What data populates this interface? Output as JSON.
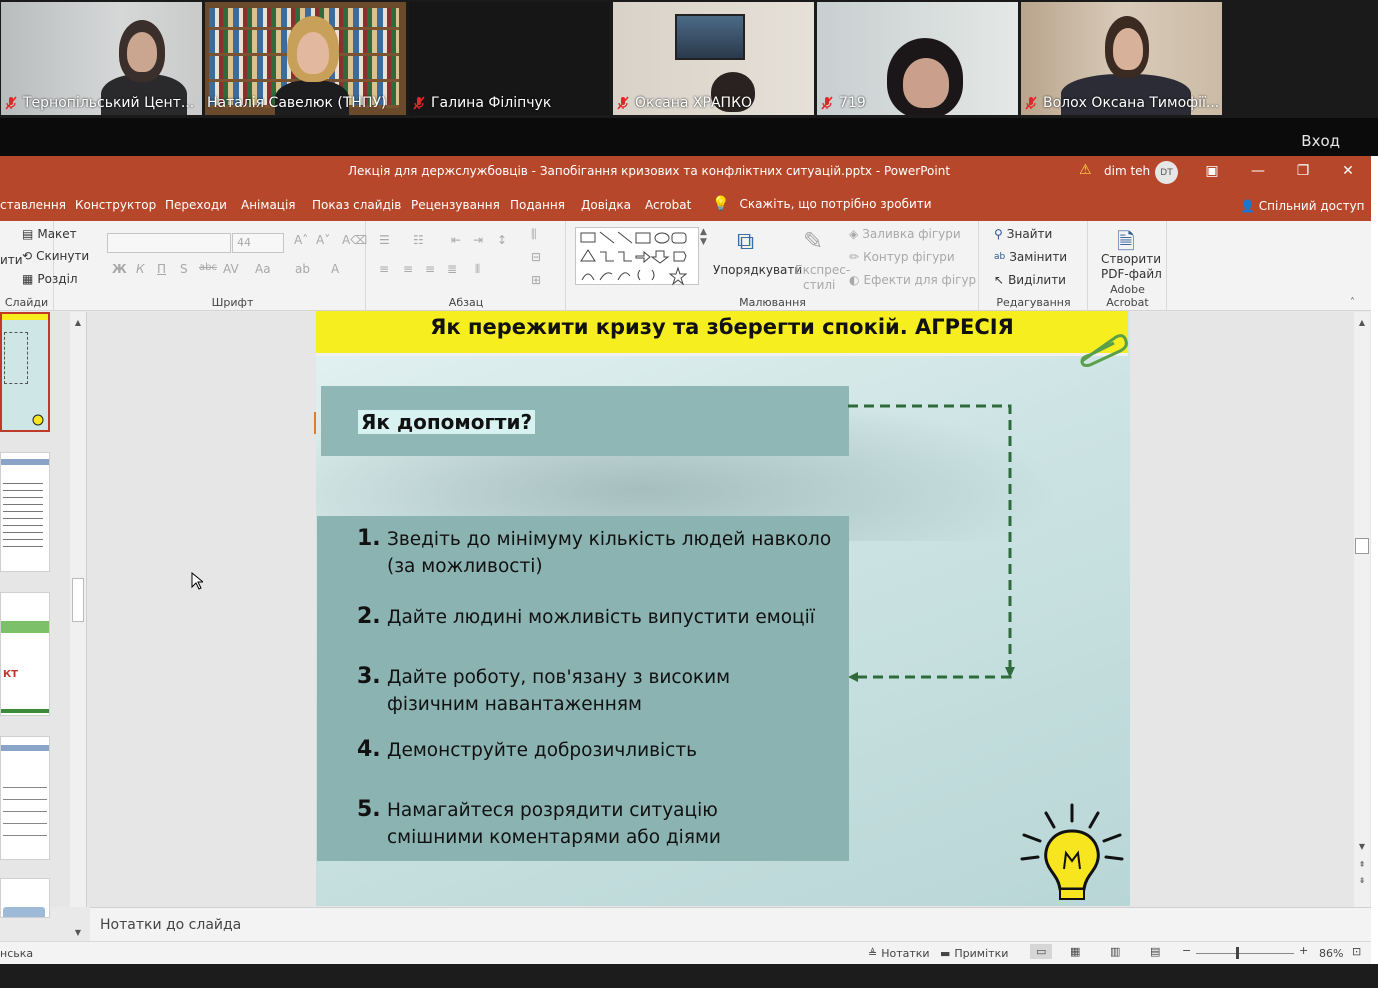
{
  "participants": [
    {
      "name": "Тернопільський Цент..."
    },
    {
      "name": "Наталія Савелюк (ТНПУ)"
    },
    {
      "name": "Галина Філіпчук"
    },
    {
      "name": "Оксана ХРАПКО"
    },
    {
      "name": "719"
    },
    {
      "name": "Волох Оксана Тимофії..."
    }
  ],
  "zoom_button": "Вход",
  "window": {
    "title": "Лекція для держслужбовців - Запобігання кризових та конфліктних ситуацій.pptx - PowerPoint",
    "user_name": "dim teh",
    "user_initials": "DT"
  },
  "menu": {
    "tabs": [
      "ставлення",
      "Конструктор",
      "Переходи",
      "Анімація",
      "Показ слайдів",
      "Рецензування",
      "Подання",
      "Довідка",
      "Acrobat"
    ],
    "tell_me": "Скажіть, що потрібно зробити",
    "share": "Спільний доступ"
  },
  "ribbon": {
    "slides_group": {
      "label": "Слайди",
      "layout": "Макет",
      "reset": "Скинути",
      "section": "Розділ",
      "partial": "ити"
    },
    "font_group": {
      "label": "Шрифт",
      "font_size": "44"
    },
    "paragraph_group": {
      "label": "Абзац"
    },
    "drawing_group": {
      "label": "Малювання",
      "arrange": "Упорядкувати",
      "quick_styles_1": "Експрес-",
      "quick_styles_2": "стилі",
      "fill": "Заливка фігури",
      "outline": "Контур фігури",
      "effects": "Ефекти для фігур"
    },
    "editing_group": {
      "label": "Редагування",
      "find": "Знайти",
      "replace": "Замінити",
      "select": "Виділити"
    },
    "acrobat_group": {
      "label": "Adobe Acrobat",
      "create_1": "Створити",
      "create_2": "PDF-файл"
    }
  },
  "slide": {
    "title": "Як пережити кризу та зберегти спокій. АГРЕСІЯ",
    "question": "Як допомогти?",
    "items": [
      {
        "num": "1.",
        "line1": "Зведіть до мінімуму кількість людей навколо",
        "line2": "(за можливості)"
      },
      {
        "num": "2.",
        "line1": "Дайте людині можливість випустити емоції",
        "line2": ""
      },
      {
        "num": "3.",
        "line1": "Дайте роботу, пов'язану з високим",
        "line2": "фізичним навантаженням"
      },
      {
        "num": "4.",
        "line1": "Демонструйте доброзичливість",
        "line2": ""
      },
      {
        "num": "5.",
        "line1": "Намагайтеся розрядити ситуацію",
        "line2": "смішними коментарями або діями"
      }
    ]
  },
  "notes_placeholder": "Нотатки до слайда",
  "status": {
    "language": "нська",
    "notes": "Нотатки",
    "comments": "Примітки",
    "zoom": "86%"
  }
}
